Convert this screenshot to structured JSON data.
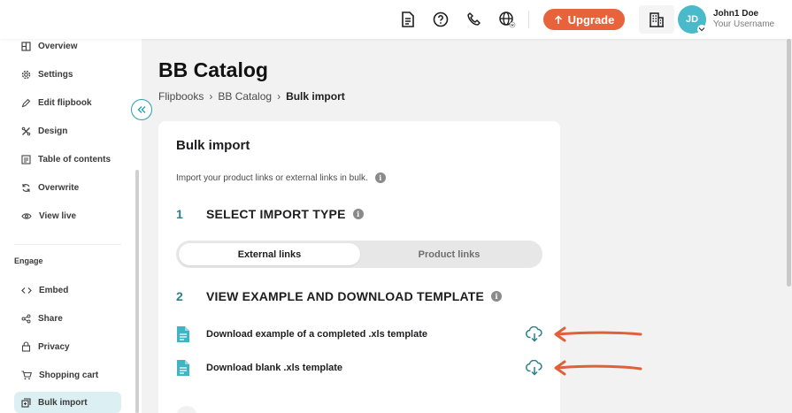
{
  "topbar": {
    "icons": [
      "document-icon",
      "help-icon",
      "phone-icon",
      "globe-icon"
    ],
    "upgrade_label": "Upgrade",
    "avatar_initials": "JD",
    "user_name": "John1 Doe",
    "user_role": "Your Username"
  },
  "sidebar": {
    "items": [
      {
        "label": "Overview",
        "icon": "overview-icon"
      },
      {
        "label": "Settings",
        "icon": "gear-icon"
      },
      {
        "label": "Edit flipbook",
        "icon": "pencil-icon"
      },
      {
        "label": "Design",
        "icon": "design-icon"
      },
      {
        "label": "Table of contents",
        "icon": "list-icon"
      },
      {
        "label": "Overwrite",
        "icon": "refresh-icon"
      },
      {
        "label": "View live",
        "icon": "eye-icon"
      }
    ],
    "section_label": "Engage",
    "engage_items": [
      {
        "label": "Embed",
        "icon": "code-icon"
      },
      {
        "label": "Share",
        "icon": "share-icon"
      },
      {
        "label": "Privacy",
        "icon": "lock-icon"
      },
      {
        "label": "Shopping cart",
        "icon": "cart-icon"
      },
      {
        "label": "Bulk import",
        "icon": "import-icon",
        "active": true
      }
    ]
  },
  "page": {
    "title": "BB Catalog",
    "breadcrumb": [
      "Flipbooks",
      "BB Catalog",
      "Bulk import"
    ]
  },
  "card": {
    "title": "Bulk import",
    "description": "Import your product links or external links in bulk.",
    "step1": {
      "num": "1",
      "title": "SELECT IMPORT TYPE"
    },
    "toggle": {
      "selected": "External links",
      "other": "Product links"
    },
    "step2": {
      "num": "2",
      "title": "VIEW EXAMPLE AND DOWNLOAD TEMPLATE"
    },
    "downloads": [
      {
        "label": "Download example of a completed .xls template"
      },
      {
        "label": "Download blank .xls template"
      }
    ]
  },
  "colors": {
    "accent": "#e8623c",
    "teal": "#2aa0ac",
    "active_bg": "#dcf0f3",
    "arrow": "#e0603a"
  }
}
